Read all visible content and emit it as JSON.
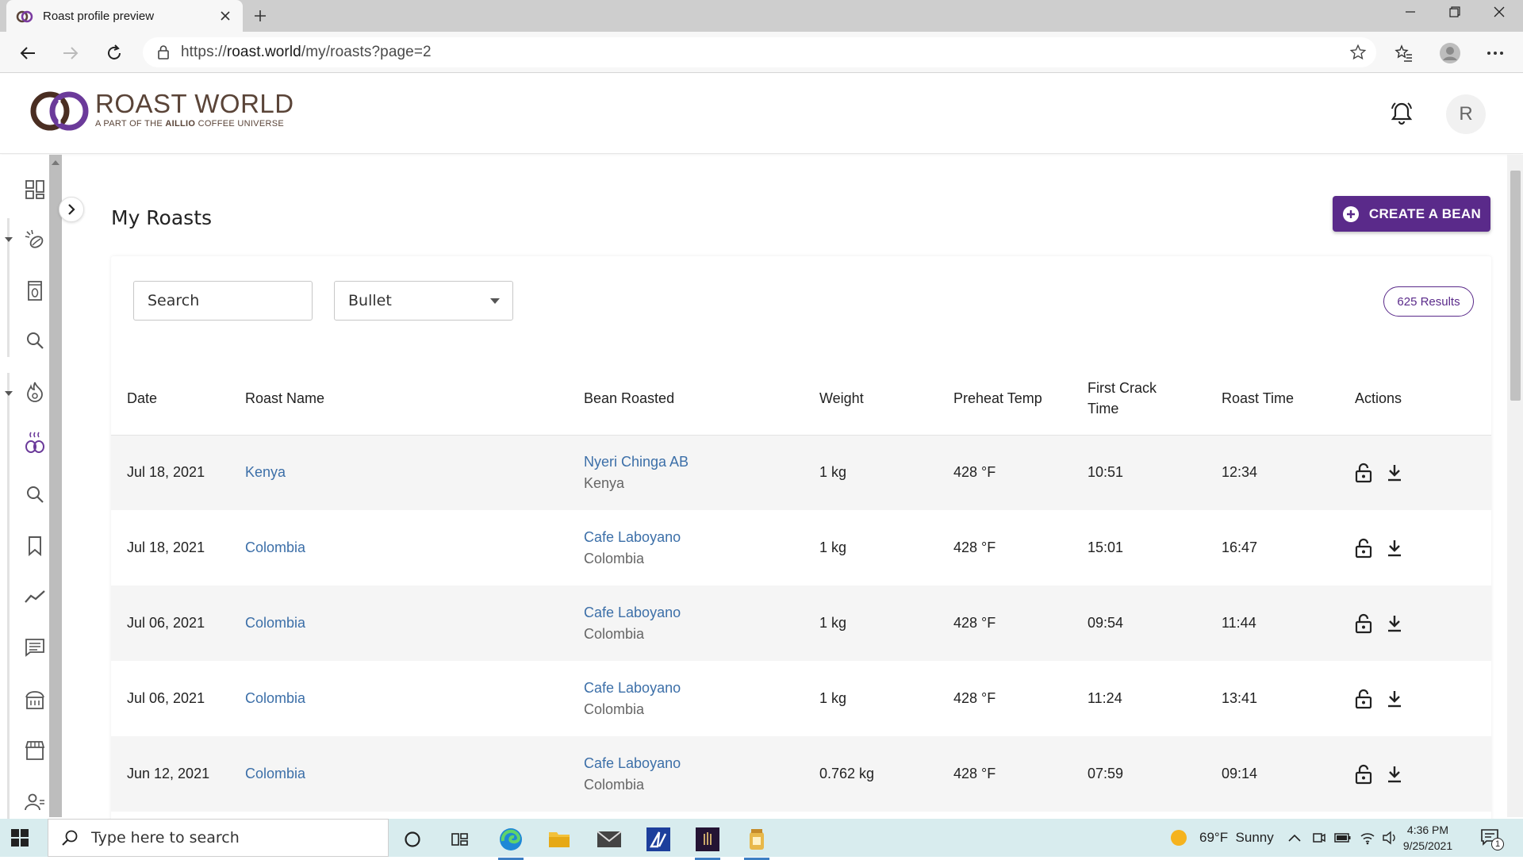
{
  "browser": {
    "tab_title": "Roast profile preview",
    "url_prefix": "https://",
    "url_domain": "roast.world",
    "url_path": "/my/roasts?page=2"
  },
  "app": {
    "brand_name": "ROAST WORLD",
    "brand_sub_prefix": "A PART OF THE ",
    "brand_sub_bold": "AILLIO",
    "brand_sub_suffix": " COFFEE UNIVERSE",
    "avatar_initial": "R",
    "accent_color": "#5a2a8a",
    "link_color": "#3c6fa8"
  },
  "page": {
    "title": "My Roasts",
    "create_button": "CREATE A BEAN",
    "search_placeholder": "Search",
    "filter_value": "Bullet",
    "results": "625 Results"
  },
  "table": {
    "headers": {
      "date": "Date",
      "name": "Roast Name",
      "bean": "Bean Roasted",
      "weight": "Weight",
      "temp": "Preheat Temp",
      "crack_1": "First Crack",
      "crack_2": "Time",
      "time": "Roast Time",
      "actions": "Actions"
    },
    "rows": [
      {
        "date": "Jul 18, 2021",
        "name": "Kenya",
        "bean": "Nyeri Chinga AB",
        "origin": "Kenya",
        "weight": "1 kg",
        "temp": "428 °F",
        "crack": "10:51",
        "time": "12:34"
      },
      {
        "date": "Jul 18, 2021",
        "name": "Colombia",
        "bean": "Cafe Laboyano",
        "origin": "Colombia",
        "weight": "1 kg",
        "temp": "428 °F",
        "crack": "15:01",
        "time": "16:47"
      },
      {
        "date": "Jul 06, 2021",
        "name": "Colombia",
        "bean": "Cafe Laboyano",
        "origin": "Colombia",
        "weight": "1 kg",
        "temp": "428 °F",
        "crack": "09:54",
        "time": "11:44"
      },
      {
        "date": "Jul 06, 2021",
        "name": "Colombia",
        "bean": "Cafe Laboyano",
        "origin": "Colombia",
        "weight": "1 kg",
        "temp": "428 °F",
        "crack": "11:24",
        "time": "13:41"
      },
      {
        "date": "Jun 12, 2021",
        "name": "Colombia",
        "bean": "Cafe Laboyano",
        "origin": "Colombia",
        "weight": "0.762 kg",
        "temp": "428 °F",
        "crack": "07:59",
        "time": "09:14"
      }
    ]
  },
  "taskbar": {
    "search_placeholder": "Type here to search",
    "weather": "69°F  Sunny",
    "time": "4:36 PM",
    "date": "9/25/2021",
    "notification_count": "1"
  },
  "icons": {
    "sidebar": [
      "dashboard-icon",
      "roast-beans-icon",
      "bean-bag-icon",
      "search-icon",
      "flame-icon",
      "coffee-cup-icon",
      "search-icon",
      "bookmark-icon",
      "trend-chart-icon",
      "chat-icon",
      "shop-icon",
      "store-icon",
      "people-icon"
    ],
    "actions": [
      "unlock-icon",
      "download-icon"
    ]
  }
}
